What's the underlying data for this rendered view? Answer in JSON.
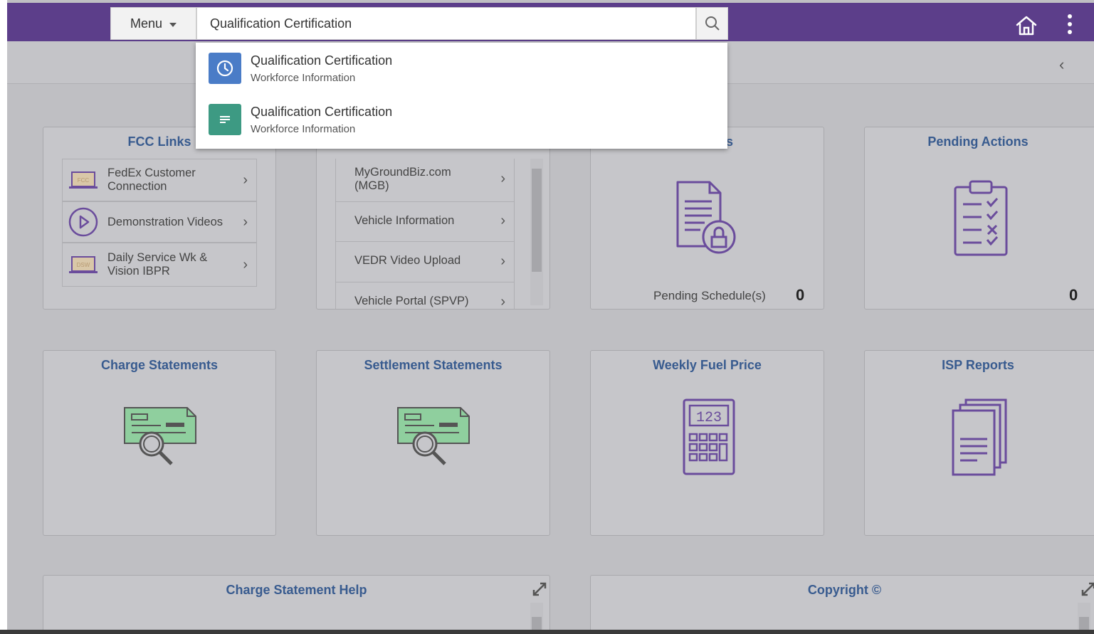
{
  "header": {
    "menu_label": "Menu",
    "search_value": "Qualification Certification",
    "icons": [
      "search-icon",
      "home-icon",
      "more-vertical-icon"
    ],
    "brand_color": "#5c3e8a"
  },
  "subbar": {
    "collapse_glyph": "‹"
  },
  "search_results": [
    {
      "title": "Qualification Certification",
      "subtitle": "Workforce Information",
      "icon": "clock-icon",
      "color": "#4a7cc7"
    },
    {
      "title": "Qualification Certification",
      "subtitle": "Workforce Information",
      "icon": "document-icon",
      "color": "#3d9a83"
    }
  ],
  "tiles": {
    "fcc_links": {
      "title": "FCC Links",
      "items": [
        {
          "label_line1": "FedEx Customer",
          "label_line2": "Connection",
          "icon": "laptop-icon",
          "icon_text": "FCC"
        },
        {
          "label_line1": "Demonstration Videos",
          "label_line2": "",
          "icon": "play-icon"
        },
        {
          "label_line1": "Daily Service Wk &",
          "label_line2": "Vision IBPR",
          "icon": "laptop-icon",
          "icon_text": "DSW"
        }
      ]
    },
    "links_2": {
      "items": [
        {
          "label_line1": "MyGroundBiz.com",
          "label_line2": "(MGB)"
        },
        {
          "label_line1": "Vehicle Information",
          "label_line2": ""
        },
        {
          "label_line1": "VEDR Video Upload",
          "label_line2": ""
        },
        {
          "label_line1": "Vehicle Portal (SPVP)",
          "label_line2": ""
        }
      ]
    },
    "schedules": {
      "title_partial": "es",
      "count_label": "Pending Schedule(s)",
      "count": "0"
    },
    "pending_actions": {
      "title": "Pending Actions",
      "count": "0"
    },
    "charge_statements": {
      "title": "Charge Statements"
    },
    "settlement_statements": {
      "title": "Settlement Statements"
    },
    "weekly_fuel_price": {
      "title": "Weekly Fuel Price",
      "icon_text": "123"
    },
    "isp_reports": {
      "title": "ISP Reports"
    },
    "charge_statement_help": {
      "title": "Charge Statement Help"
    },
    "copyright": {
      "title": "Copyright ©"
    }
  },
  "chevron": "›",
  "accent_colors": {
    "tile_title": "#385b8f",
    "icon_purple": "#6a4c9c",
    "icon_green": "#8fcf9e"
  }
}
